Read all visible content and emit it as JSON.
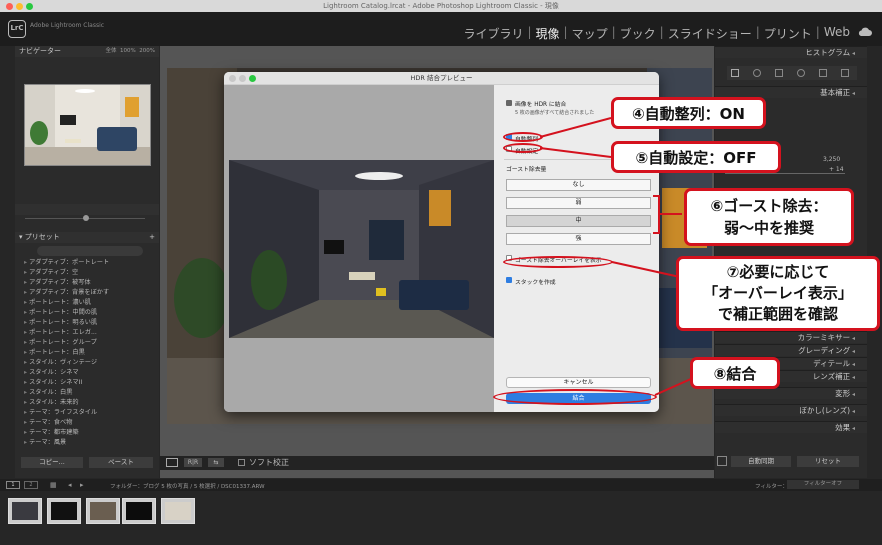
{
  "window": {
    "title": "Lightroom Catalog.lrcat - Adobe Photoshop Lightroom Classic - 現像"
  },
  "topbar": {
    "logo": "LrC",
    "app_name": "Adobe Lightroom Classic",
    "modules": [
      "ライブラリ",
      "現像",
      "マップ",
      "ブック",
      "スライドショー",
      "プリント",
      "Web"
    ],
    "active_module": "現像"
  },
  "left_panel": {
    "navigator_label": "ナビゲーター",
    "navigator_zoom": [
      "全体",
      "100%",
      "200%"
    ],
    "presets_label": "プリセット",
    "preset_items": [
      "アダプティブ：ポートレート",
      "アダプティブ：空",
      "アダプティブ：被写体",
      "アダプティブ：背景をぼかす",
      "ポートレート：濃い肌",
      "ポートレート：中間の肌",
      "ポートレート：明るい肌",
      "ポートレート：エレガ...",
      "ポートレート：グループ",
      "ポートレート：白黒",
      "スタイル：ヴィンテージ",
      "スタイル：シネマ",
      "スタイル：シネマII",
      "スタイル：白黒",
      "スタイル：未来的",
      "テーマ：ライフスタイル",
      "テーマ：食べ物",
      "テーマ：都市建築",
      "テーマ：風景"
    ],
    "copy_button": "コピー...",
    "paste_button": "ペースト"
  },
  "center": {
    "toolbar_label": "ソフト校正"
  },
  "dialog": {
    "title": "HDR 結合プレビュー",
    "merge_heading": "画像を HDR に結合",
    "merge_sub": "5 枚の画像がすべて結合されました",
    "auto_align_label": "自動整列",
    "auto_align_checked": true,
    "auto_settings_label": "自動設定",
    "auto_settings_checked": false,
    "deghost_label": "ゴースト除去量",
    "deghost_options": [
      "なし",
      "弱",
      "中",
      "強"
    ],
    "deghost_selected": "中",
    "overlay_label": "ゴースト除去オーバーレイを表示",
    "overlay_checked": false,
    "stack_label": "スタックを作成",
    "stack_checked": true,
    "cancel_button": "キャンセル",
    "merge_button": "結合"
  },
  "right_panel": {
    "histogram_label": "ヒストグラム",
    "basic_label": "基本補正",
    "value_top": "3,250",
    "value_bottom": "+ 14",
    "sections": [
      "カラーミキサー",
      "グレーディング",
      "ディテール",
      "レンズ補正",
      "変形",
      "ぼかし(レンズ)",
      "効果"
    ],
    "auto_sync_button": "自動同期",
    "reset_button": "リセット"
  },
  "filmstrip": {
    "folder_text": "フォルダー：ブログ   5 枚の写真 / 5 枚選択 / DSC01337.ARW",
    "filter_label": "フィルター：",
    "filter_value": "フィルターオフ"
  },
  "annotations": {
    "a4": "④自動整列：ON",
    "a5": "⑤自動設定：OFF",
    "a6_line1": "⑥ゴースト除去：",
    "a6_line2": "弱〜中を推奨",
    "a7_line1": "⑦必要に応じて",
    "a7_line2": "「オーバーレイ表示」",
    "a7_line3": "で補正範囲を確認",
    "a8": "⑧結合"
  },
  "colors": {
    "accent_red": "#d4121e",
    "merge_blue": "#2e7de1"
  }
}
